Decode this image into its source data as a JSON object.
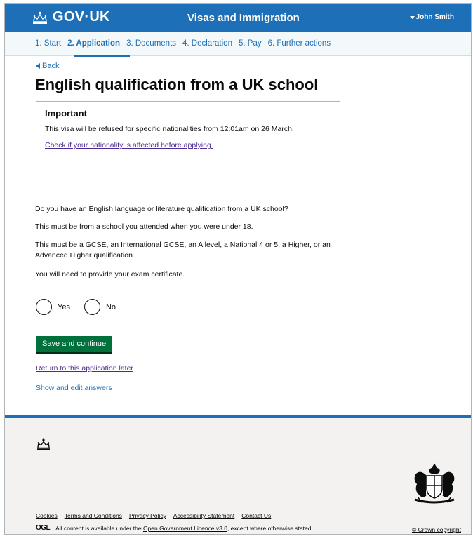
{
  "header": {
    "logo_text": "GOV·UK",
    "service_name": "Visas and Immigration",
    "user_name": "John Smith"
  },
  "steps": [
    {
      "label": "1. Start",
      "active": false
    },
    {
      "label": "2. Application",
      "active": true
    },
    {
      "label": "3. Documents",
      "active": false
    },
    {
      "label": "4. Declaration",
      "active": false
    },
    {
      "label": "5. Pay",
      "active": false
    },
    {
      "label": "6. Further actions",
      "active": false
    }
  ],
  "back_label": "Back",
  "page_title": "English qualification from a UK school",
  "notice": {
    "heading": "Important",
    "text": "This visa will be refused for specific nationalities from 12:01am on 26 March.",
    "link": "Check if your nationality is affected before applying."
  },
  "question": {
    "line1": "Do you have an English language or literature qualification from a UK school?",
    "line2": "This must be from a school you attended when you were under 18.",
    "line3": "This must be a GCSE, an International GCSE, an A level, a National 4 or 5, a Higher, or an Advanced Higher qualification.",
    "line4": "You will need to provide your exam certificate."
  },
  "options": {
    "yes": "Yes",
    "no": "No"
  },
  "save_button": "Save and continue",
  "return_link": "Return to this application later",
  "show_link": "Show and edit answers",
  "footer": {
    "links": [
      "Cookies",
      "Terms and Conditions",
      "Privacy Policy",
      "Accessibility Statement",
      "Contact Us"
    ],
    "ogl": "OGL",
    "licence_prefix": "All content is available under the",
    "licence_link": "Open Government Licence v3.0",
    "licence_suffix": ", except where otherwise stated",
    "copyright": "© Crown copyright"
  },
  "colors": {
    "brand_blue": "#1d70b8",
    "button_green": "#00703c",
    "visited_link": "#4c2c92"
  }
}
